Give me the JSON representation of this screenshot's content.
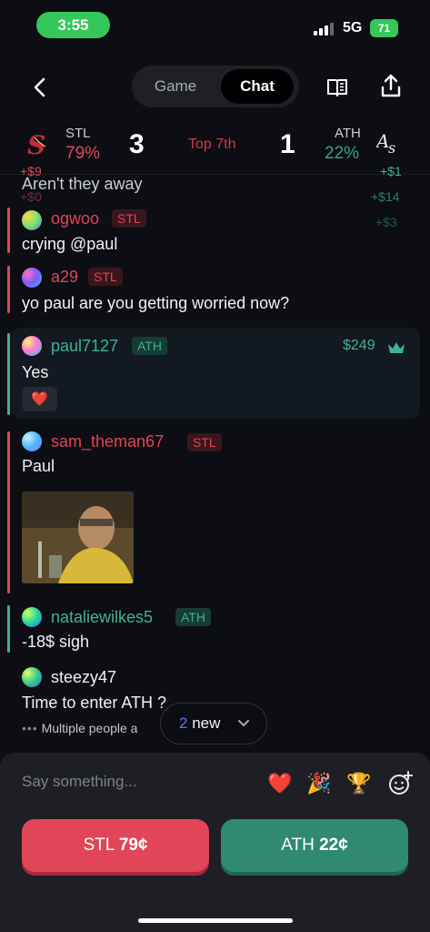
{
  "status": {
    "time": "3:55",
    "network": "5G",
    "battery": "71"
  },
  "nav": {
    "tabs": [
      {
        "label": "Game"
      },
      {
        "label": "Chat"
      }
    ],
    "active_tab": "Chat"
  },
  "scoreboard": {
    "home": {
      "abbr": "STL",
      "pct": "79%",
      "runs": "3"
    },
    "away": {
      "abbr": "ATH",
      "pct": "22%",
      "runs": "1"
    },
    "inning": "Top 7th",
    "floating_amounts": [
      "+$9",
      "+$0",
      "+$1",
      "+$14",
      "+$3"
    ]
  },
  "messages": [
    {
      "user": "",
      "text": "Aren't they away"
    },
    {
      "user": "ogwoo",
      "team": "STL",
      "text": "crying @paul"
    },
    {
      "user": "a29",
      "team": "STL",
      "text": "yo paul are you getting worried now?"
    },
    {
      "user": "paul7127",
      "team": "ATH",
      "text": "Yes",
      "stake": "$249",
      "reaction": "❤️"
    },
    {
      "user": "sam_theman67",
      "team": "STL",
      "text": "Paul"
    },
    {
      "user": "nataliewilkes5",
      "team": "ATH",
      "text": "-18$ sigh"
    },
    {
      "user": "steezy47",
      "team": "",
      "text": "Time to enter ATH ?"
    }
  ],
  "typing_indicator": "Multiple people a",
  "new_messages": {
    "count": "2",
    "label": "new"
  },
  "composer": {
    "placeholder": "Say something...",
    "reactions": [
      "❤️",
      "🎉",
      "🏆"
    ]
  },
  "buy_buttons": [
    {
      "team": "STL",
      "price": "79¢",
      "color": "#e24558"
    },
    {
      "team": "ATH",
      "price": "22¢",
      "color": "#2f8a70"
    }
  ],
  "colors": {
    "stl": "#e14557",
    "ath": "#3fb38f",
    "background": "#0c0e13"
  }
}
